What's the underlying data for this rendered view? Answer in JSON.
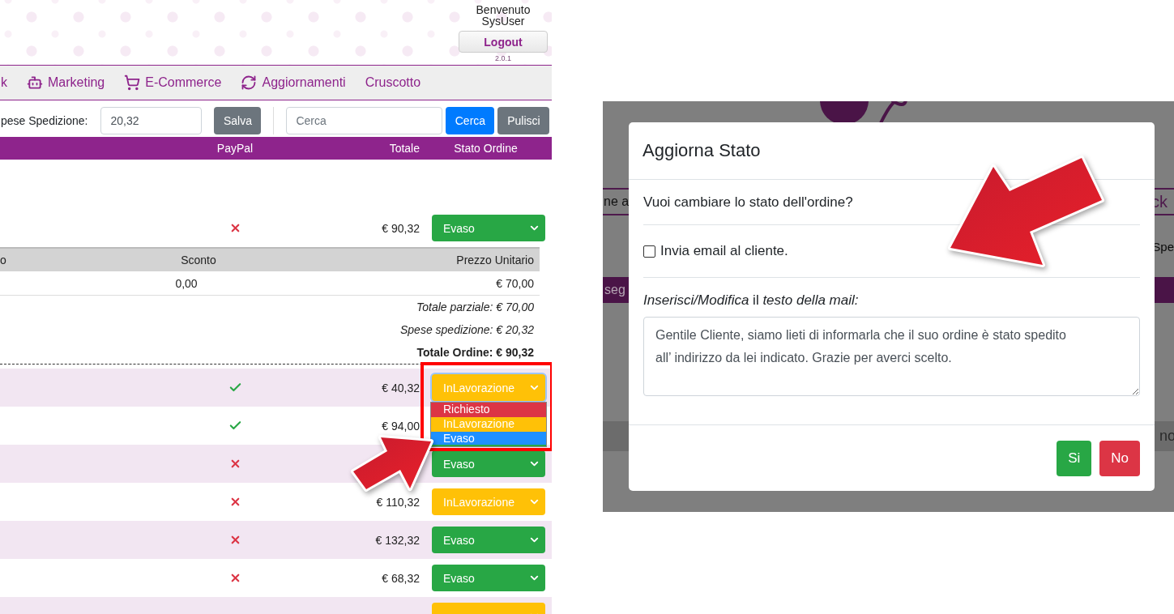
{
  "header": {
    "greeting": "Benvenuto",
    "user": "SysUser",
    "logout": "Logout",
    "version": "2.0.1"
  },
  "nav": [
    {
      "label": "k",
      "kind": "plain"
    },
    {
      "label": "Marketing",
      "kind": "robot"
    },
    {
      "label": "E-Commerce",
      "kind": "cart"
    },
    {
      "label": "Aggiornamenti",
      "kind": "refresh"
    },
    {
      "label": "Cruscotto",
      "kind": "plain"
    }
  ],
  "toolbar": {
    "shipping_label": "pese Spedizione:",
    "shipping_value": "20,32",
    "save": "Salva",
    "search_placeholder": "Cerca",
    "search": "Cerca",
    "clear": "Pulisci"
  },
  "table": {
    "columns": [
      "PayPal",
      "Totale",
      "Stato Ordine"
    ],
    "rows": [
      {
        "paypal": false,
        "total": "€ 90,32",
        "status": {
          "label": "Evaso",
          "kind": "done"
        },
        "details": {
          "columns": [
            "o",
            "Sconto",
            "Prezzo Unitario"
          ],
          "discount": "0,00",
          "unit_price": "€ 70,00",
          "subtotals": [
            "Totale parziale: € 70,00",
            "Spese spedizione: € 20,32"
          ],
          "grand_total": "Totale Ordine: € 90,32"
        }
      },
      {
        "paypal": true,
        "total": "€ 40,32",
        "status": {
          "label": "InLavorazione",
          "kind": "progress",
          "options": [
            {
              "label": "Richiesto",
              "kind": "requested",
              "selected": false
            },
            {
              "label": "InLavorazione",
              "kind": "progress",
              "selected": false
            },
            {
              "label": "Evaso",
              "kind": "done",
              "selected": true
            }
          ]
        }
      },
      {
        "paypal": true,
        "total": "€ 94,00"
      },
      {
        "paypal": false,
        "status": {
          "label": "Evaso",
          "kind": "done"
        }
      },
      {
        "paypal": false,
        "total": "€ 110,32",
        "status": {
          "label": "InLavorazione",
          "kind": "progress"
        }
      },
      {
        "paypal": false,
        "total": "€ 132,32",
        "status": {
          "label": "Evaso",
          "kind": "done"
        }
      },
      {
        "paypal": false,
        "total": "€ 68,32",
        "status": {
          "label": "Evaso",
          "kind": "done"
        }
      },
      {
        "status": {
          "kind": "progress"
        }
      }
    ]
  },
  "modal_backdrop": {
    "nav_left": "ne a",
    "nav_right": "ck",
    "toolbar_right": "Spe",
    "bar_left": "seg",
    "table_right": "no"
  },
  "modal": {
    "title": "Aggiorna Stato",
    "question": "Vuoi cambiare lo stato dell'ordine?",
    "checkbox": {
      "label": "Invia email al cliente.",
      "checked": false
    },
    "mail_label": "*Inserisci/Modifica* il *testo della mail:*",
    "mail_text": "Gentile Cliente, siamo lieti di informarla che il suo ordine è stato spedito all’ indirizzo da lei indicato. Grazie per averci scelto.",
    "buttons": [
      {
        "label": "Si",
        "kind": "confirm"
      },
      {
        "label": "No",
        "kind": "cancel"
      }
    ]
  }
}
